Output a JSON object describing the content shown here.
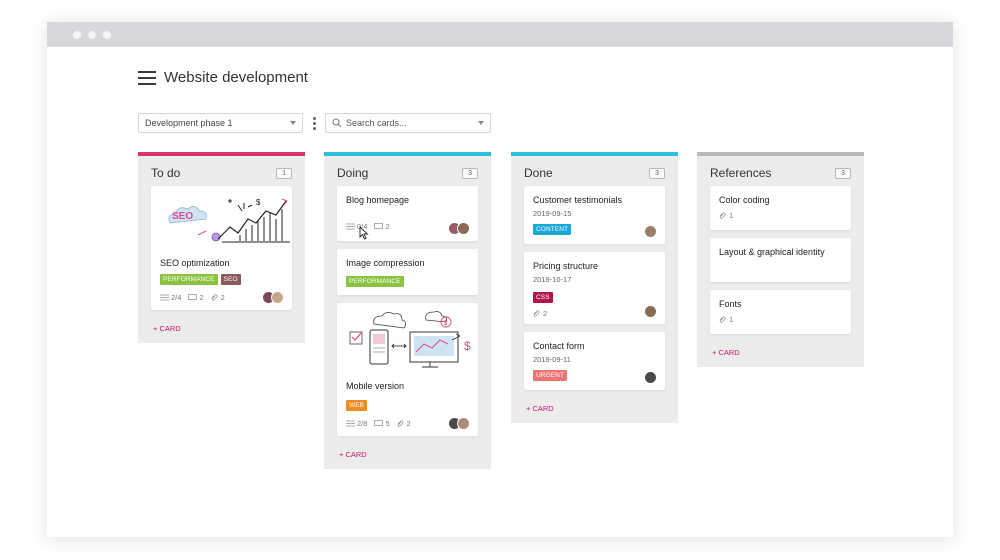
{
  "board": {
    "title": "Website development"
  },
  "toolbar": {
    "phase": "Development phase 1",
    "search_placeholder": "Search cards..."
  },
  "colors": {
    "accent": "#c7176b",
    "todo": "#d9336f",
    "doing": "#2ec1dc",
    "done": "#2ec1dc",
    "references": "#b9b9b9"
  },
  "columns": [
    {
      "title": "To do",
      "count": "1",
      "add_label": "+ CARD",
      "cards": [
        {
          "title": "SEO optimization",
          "illustration": "seo-growth-chart",
          "tags": [
            {
              "label": "PERFORMANCE",
              "color": "#8ac33f"
            },
            {
              "label": "SEO",
              "color": "#8a5a5a"
            }
          ],
          "checklist": "2/4",
          "comments": "2",
          "attachments": "2"
        }
      ]
    },
    {
      "title": "Doing",
      "count": "3",
      "add_label": "+ CARD",
      "cards": [
        {
          "title": "Blog homepage",
          "checklist": "0/4",
          "comments": "2"
        },
        {
          "title": "Image compression",
          "tags": [
            {
              "label": "PERFORMANCE",
              "color": "#8ac33f"
            }
          ]
        },
        {
          "title": "Mobile version",
          "illustration": "devices-sketch",
          "tags": [
            {
              "label": "WEB",
              "color": "#f08c1d"
            }
          ],
          "checklist": "2/8",
          "comments": "5",
          "attachments": "2"
        }
      ]
    },
    {
      "title": "Done",
      "count": "3",
      "add_label": "+ CARD",
      "cards": [
        {
          "title": "Customer testimonials",
          "date": "2019-09-15",
          "tags": [
            {
              "label": "CONTENT",
              "color": "#19a9d8"
            }
          ]
        },
        {
          "title": "Pricing structure",
          "date": "2019-10-17",
          "tags": [
            {
              "label": "CSS",
              "color": "#b1154f"
            }
          ],
          "attachments": "2"
        },
        {
          "title": "Contact form",
          "date": "2019-09-11",
          "tags": [
            {
              "label": "URGENT",
              "color": "#ee7474"
            }
          ]
        }
      ]
    },
    {
      "title": "References",
      "count": "3",
      "add_label": "+ CARD",
      "cards": [
        {
          "title": "Color coding",
          "attachments": "1"
        },
        {
          "title": "Layout & graphical identity"
        },
        {
          "title": "Fonts",
          "attachments": "1"
        }
      ]
    }
  ]
}
